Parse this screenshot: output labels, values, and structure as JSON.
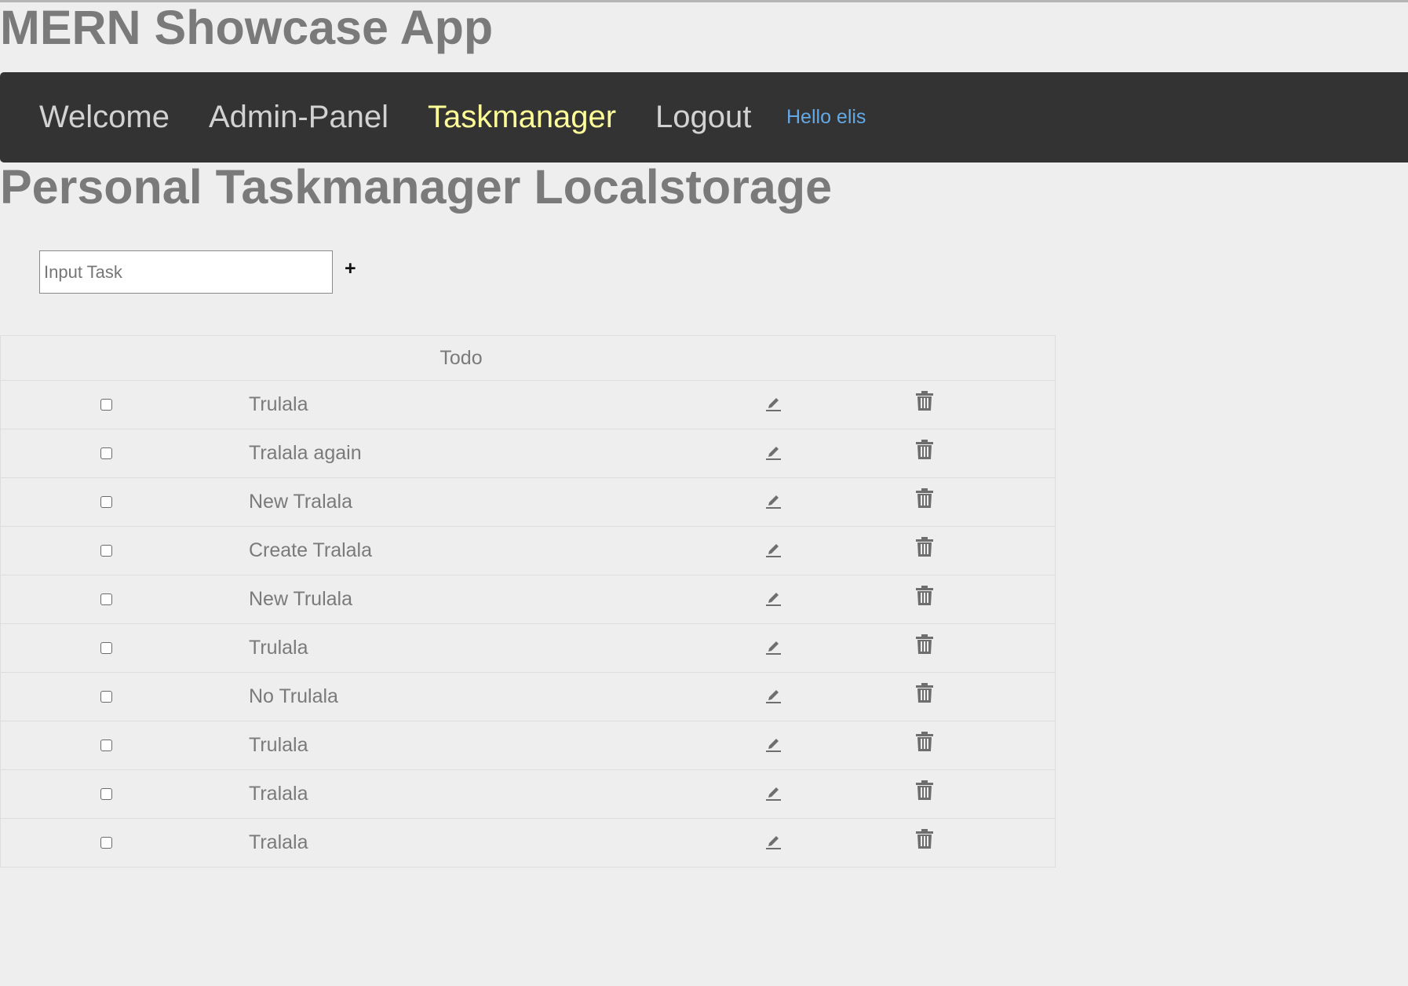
{
  "app": {
    "title": "MERN Showcase App"
  },
  "nav": {
    "links": [
      {
        "label": "Welcome"
      },
      {
        "label": "Admin-Panel"
      },
      {
        "label": "Taskmanager"
      },
      {
        "label": "Logout"
      }
    ],
    "active": "Taskmanager",
    "greeting": "Hello elis"
  },
  "page": {
    "title": "Personal Taskmanager Localstorage"
  },
  "task_input": {
    "placeholder": "Input Task",
    "value": "",
    "add_label": "+"
  },
  "table": {
    "header": "Todo",
    "rows": [
      {
        "text": "Trulala",
        "done": false
      },
      {
        "text": "Tralala again",
        "done": false
      },
      {
        "text": "New Tralala",
        "done": false
      },
      {
        "text": "Create Tralala",
        "done": false
      },
      {
        "text": "New Trulala",
        "done": false
      },
      {
        "text": "Trulala",
        "done": false
      },
      {
        "text": "No Trulala",
        "done": false
      },
      {
        "text": "Trulala",
        "done": false
      },
      {
        "text": "Tralala",
        "done": false
      },
      {
        "text": "Tralala",
        "done": false
      }
    ],
    "edit_icon": "pencil-icon",
    "delete_icon": "trash-icon"
  },
  "colors": {
    "navbar": "#333333",
    "nav_link": "#d2d2d2",
    "nav_active": "#ffff99",
    "greeting": "#63a9e6",
    "text_gray": "#7a7a7a",
    "background": "#eeeeee"
  }
}
